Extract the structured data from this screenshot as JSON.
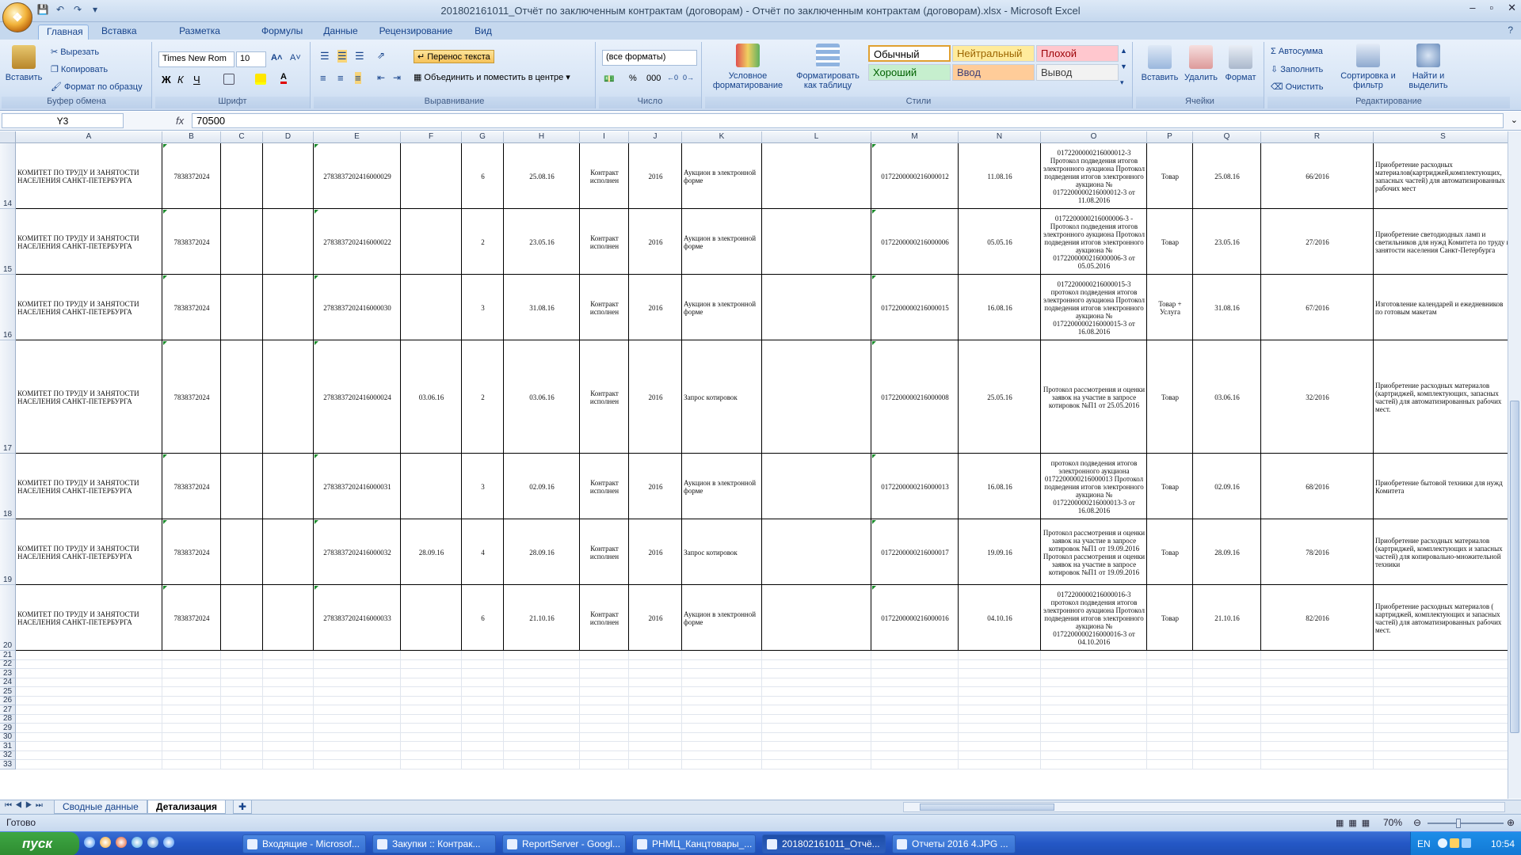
{
  "window": {
    "title": "201802161011_Отчёт по заключенным контрактам (договорам) - Отчёт по заключенным контрактам (договорам).xlsx - Microsoft Excel",
    "minimize": "–",
    "maximize": "▫",
    "close": "✕"
  },
  "ribbon_tabs": [
    "Главная",
    "Вставка",
    "Разметка страницы",
    "Формулы",
    "Данные",
    "Рецензирование",
    "Вид"
  ],
  "ribbon": {
    "clipboard": {
      "label": "Буфер обмена",
      "paste": "Вставить",
      "cut": "Вырезать",
      "copy": "Копировать",
      "format_painter": "Формат по образцу"
    },
    "font": {
      "label": "Шрифт",
      "name": "Times New Rom",
      "size": "10",
      "bold": "Ж",
      "italic": "К",
      "underline": "Ч"
    },
    "alignment": {
      "label": "Выравнивание",
      "wrap": "Перенос текста",
      "merge": "Объединить и поместить в центре"
    },
    "number": {
      "label": "Число",
      "format": "(все форматы)",
      "percent": "%",
      "thousands": "000"
    },
    "styles": {
      "label": "Стили",
      "conditional": "Условное форматирование",
      "as_table": "Форматировать как таблицу",
      "cells": [
        {
          "name": "Обычный",
          "bg": "#ffffff",
          "fg": "#000000"
        },
        {
          "name": "Нейтральный",
          "bg": "#ffeb9c",
          "fg": "#9c6500"
        },
        {
          "name": "Плохой",
          "bg": "#ffc7ce",
          "fg": "#9c0006"
        },
        {
          "name": "Хороший",
          "bg": "#c6efce",
          "fg": "#006100"
        },
        {
          "name": "Ввод",
          "bg": "#ffcc99",
          "fg": "#3f3f76"
        },
        {
          "name": "Вывод",
          "bg": "#f2f2f2",
          "fg": "#3f3f3f"
        }
      ]
    },
    "cells": {
      "label": "Ячейки",
      "insert": "Вставить",
      "delete": "Удалить",
      "format": "Формат"
    },
    "editing": {
      "label": "Редактирование",
      "autosum": "Автосумма",
      "fill": "Заполнить",
      "clear": "Очистить",
      "sort": "Сортировка и фильтр",
      "find": "Найти и выделить"
    }
  },
  "formula_bar": {
    "name_box": "Y3",
    "fx": "fx",
    "value": "70500"
  },
  "columns": [
    "A",
    "B",
    "C",
    "D",
    "E",
    "F",
    "G",
    "H",
    "I",
    "J",
    "K",
    "L",
    "M",
    "N",
    "O",
    "P",
    "Q",
    "R",
    "S"
  ],
  "rows": [
    {
      "num": "14",
      "a": "КОМИТЕТ ПО ТРУДУ И ЗАНЯТОСТИ НАСЕЛЕНИЯ САНКТ-ПЕТЕРБУРГА",
      "b": "7838372024",
      "e": "2783837202416000029",
      "f": "",
      "g": "6",
      "h": "25.08.16",
      "i": "Контракт исполнен",
      "j": "2016",
      "k": "Аукцион в электронной форме",
      "m": "0172200000216000012",
      "n": "11.08.16",
      "o": "0172200000216000012-3 Протокол подведения итогов электронного аукциона Протокол подведения итогов электронного аукциона № 0172200000216000012-3 от 11.08.2016",
      "p": "Товар",
      "q": "25.08.16",
      "r": "66/2016",
      "s": "Приобретение расходных материалов(картриджей,комплектующих, запасных частей) для автоматизированных рабочих мест"
    },
    {
      "num": "15",
      "a": "КОМИТЕТ ПО ТРУДУ И ЗАНЯТОСТИ НАСЕЛЕНИЯ САНКТ-ПЕТЕРБУРГА",
      "b": "7838372024",
      "e": "2783837202416000022",
      "f": "",
      "g": "2",
      "h": "23.05.16",
      "i": "Контракт исполнен",
      "j": "2016",
      "k": "Аукцион в электронной форме",
      "m": "0172200000216000006",
      "n": "05.05.16",
      "o": "0172200000216000006-3 - Протокол подведения итогов электронного аукциона Протокол подведения итогов электронного аукциона № 0172200000216000006-3 от 05.05.2016",
      "p": "Товар",
      "q": "23.05.16",
      "r": "27/2016",
      "s": "Приобретение светодиодных ламп и светильников для нужд Комитета по труду и занятости населения Санкт-Петербурга"
    },
    {
      "num": "16",
      "a": "КОМИТЕТ ПО ТРУДУ И ЗАНЯТОСТИ НАСЕЛЕНИЯ САНКТ-ПЕТЕРБУРГА",
      "b": "7838372024",
      "e": "2783837202416000030",
      "f": "",
      "g": "3",
      "h": "31.08.16",
      "i": "Контракт исполнен",
      "j": "2016",
      "k": "Аукцион в электронной форме",
      "m": "0172200000216000015",
      "n": "16.08.16",
      "o": "0172200000216000015-3 протокол подведения итогов электронного аукциона Протокол подведения итогов электронного аукциона № 0172200000216000015-3 от 16.08.2016",
      "p": "Товар + Услуга",
      "q": "31.08.16",
      "r": "67/2016",
      "s": "Изготовление календарей и ежедневников по готовым макетам"
    },
    {
      "num": "17",
      "a": "КОМИТЕТ ПО ТРУДУ И ЗАНЯТОСТИ НАСЕЛЕНИЯ САНКТ-ПЕТЕРБУРГА",
      "b": "7838372024",
      "e": "2783837202416000024",
      "f": "03.06.16",
      "g": "2",
      "h": "03.06.16",
      "i": "Контракт исполнен",
      "j": "2016",
      "k": "Запрос котировок",
      "m": "0172200000216000008",
      "n": "25.05.16",
      "o": "Протокол рассмотрения и оценки заявок на участие в запросе котировок №П1 от 25.05.2016",
      "p": "Товар",
      "q": "03.06.16",
      "r": "32/2016",
      "s": "Приобретение расходных материалов (картриджей, комплектующих, запасных частей) для автоматизированных рабочих мест."
    },
    {
      "num": "18",
      "a": "КОМИТЕТ ПО ТРУДУ И ЗАНЯТОСТИ НАСЕЛЕНИЯ САНКТ-ПЕТЕРБУРГА",
      "b": "7838372024",
      "e": "2783837202416000031",
      "f": "",
      "g": "3",
      "h": "02.09.16",
      "i": "Контракт исполнен",
      "j": "2016",
      "k": "Аукцион в электронной форме",
      "m": "0172200000216000013",
      "n": "16.08.16",
      "o": "протокол подведения итогов электронного аукциона 0172200000216000013 Протокол подведения итогов электронного аукциона № 0172200000216000013-3 от 16.08.2016",
      "p": "Товар",
      "q": "02.09.16",
      "r": "68/2016",
      "s": "Приобретение бытовой техники для нужд Комитета"
    },
    {
      "num": "19",
      "a": "КОМИТЕТ ПО ТРУДУ И ЗАНЯТОСТИ НАСЕЛЕНИЯ САНКТ-ПЕТЕРБУРГА",
      "b": "7838372024",
      "e": "2783837202416000032",
      "f": "28.09.16",
      "g": "4",
      "h": "28.09.16",
      "i": "Контракт исполнен",
      "j": "2016",
      "k": "Запрос котировок",
      "m": "0172200000216000017",
      "n": "19.09.16",
      "o": "Протокол рассмотрения и оценки заявок на участие в запросе котировок №П1 от 19.09.2016 Протокол рассмотрения и оценки заявок на участие в запросе котировок №П1 от 19.09.2016",
      "p": "Товар",
      "q": "28.09.16",
      "r": "78/2016",
      "s": "Приобретение расходных материалов (картриджей, комплектующих и запасных частей) для копировально-множительной техники"
    },
    {
      "num": "20",
      "a": "КОМИТЕТ ПО ТРУДУ И ЗАНЯТОСТИ НАСЕЛЕНИЯ САНКТ-ПЕТЕРБУРГА",
      "b": "7838372024",
      "e": "2783837202416000033",
      "f": "",
      "g": "6",
      "h": "21.10.16",
      "i": "Контракт исполнен",
      "j": "2016",
      "k": "Аукцион в электронной форме",
      "m": "0172200000216000016",
      "n": "04.10.16",
      "o": "0172200000216000016-3 протокол подведения итогов электронного аукциона Протокол подведения итогов электронного аукциона № 0172200000216000016-3 от 04.10.2016",
      "p": "Товар",
      "q": "21.10.16",
      "r": "82/2016",
      "s": "Приобретение расходных материалов ( картриджей, комплектующих и запасных частей) для автоматизированных рабочих мест."
    }
  ],
  "empty_rows": [
    "21",
    "22",
    "23",
    "24",
    "25",
    "26",
    "27",
    "28",
    "29",
    "30",
    "31",
    "32",
    "33"
  ],
  "sheet_tabs": [
    "Сводные данные",
    "Детализация"
  ],
  "status": {
    "ready": "Готово",
    "zoom": "70%"
  },
  "taskbar": {
    "start": "пуск",
    "items": [
      "Входящие - Microsof...",
      "Закупки :: Контрак...",
      "ReportServer - Googl...",
      "РНМЦ_Канцтовары_...",
      "201802161011_Отчё...",
      "Отчеты 2016 4.JPG ..."
    ],
    "lang": "EN",
    "clock": "10:54"
  }
}
